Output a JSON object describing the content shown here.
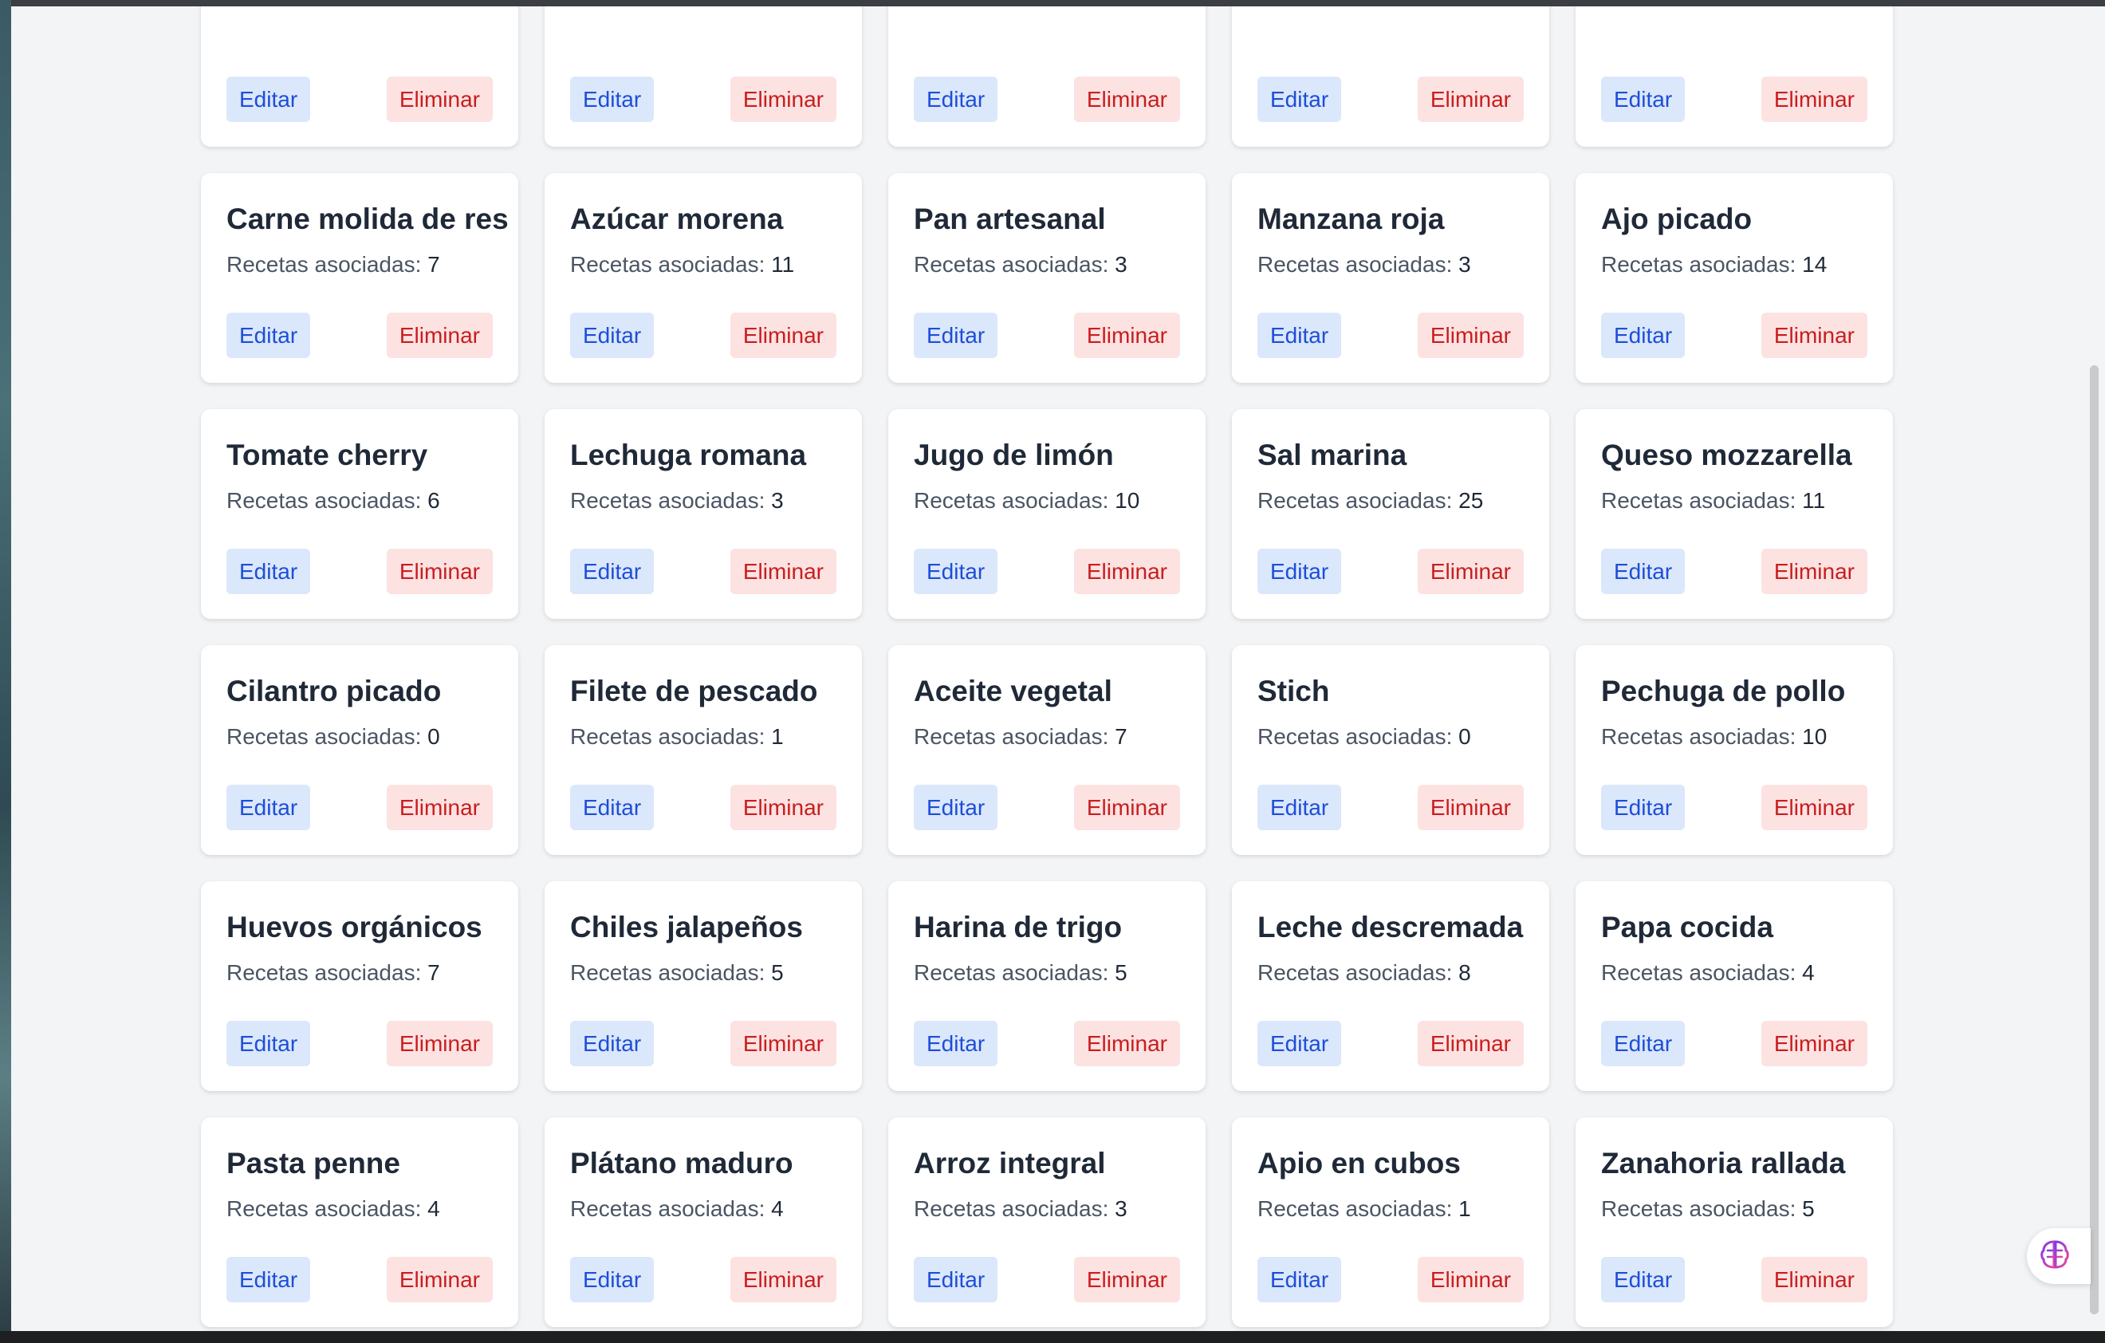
{
  "labels": {
    "count_prefix": "Recetas asociadas: ",
    "edit": "Editar",
    "delete": "Eliminar"
  },
  "top_row_partial": [
    "",
    "",
    "",
    "",
    ""
  ],
  "ingredients": [
    {
      "name": "Carne molida de res",
      "count": "7"
    },
    {
      "name": "Azúcar morena",
      "count": "11"
    },
    {
      "name": "Pan artesanal",
      "count": "3"
    },
    {
      "name": "Manzana roja",
      "count": "3"
    },
    {
      "name": "Ajo picado",
      "count": "14"
    },
    {
      "name": "Tomate cherry",
      "count": "6"
    },
    {
      "name": "Lechuga romana",
      "count": "3"
    },
    {
      "name": "Jugo de limón",
      "count": "10"
    },
    {
      "name": "Sal marina",
      "count": "25"
    },
    {
      "name": "Queso mozzarella",
      "count": "11"
    },
    {
      "name": "Cilantro picado",
      "count": "0"
    },
    {
      "name": "Filete de pescado",
      "count": "1"
    },
    {
      "name": "Aceite vegetal",
      "count": "7"
    },
    {
      "name": "Stich",
      "count": "0"
    },
    {
      "name": "Pechuga de pollo",
      "count": "10"
    },
    {
      "name": "Huevos orgánicos",
      "count": "7"
    },
    {
      "name": "Chiles jalapeños",
      "count": "5"
    },
    {
      "name": "Harina de trigo",
      "count": "5"
    },
    {
      "name": "Leche descremada",
      "count": "8"
    },
    {
      "name": "Papa cocida",
      "count": "4"
    },
    {
      "name": "Pasta penne",
      "count": "4"
    },
    {
      "name": "Plátano maduro",
      "count": "4"
    },
    {
      "name": "Arroz integral",
      "count": "3"
    },
    {
      "name": "Apio en cubos",
      "count": "1"
    },
    {
      "name": "Zanahoria rallada",
      "count": "5"
    }
  ],
  "fab": {
    "icon": "brain-icon"
  }
}
